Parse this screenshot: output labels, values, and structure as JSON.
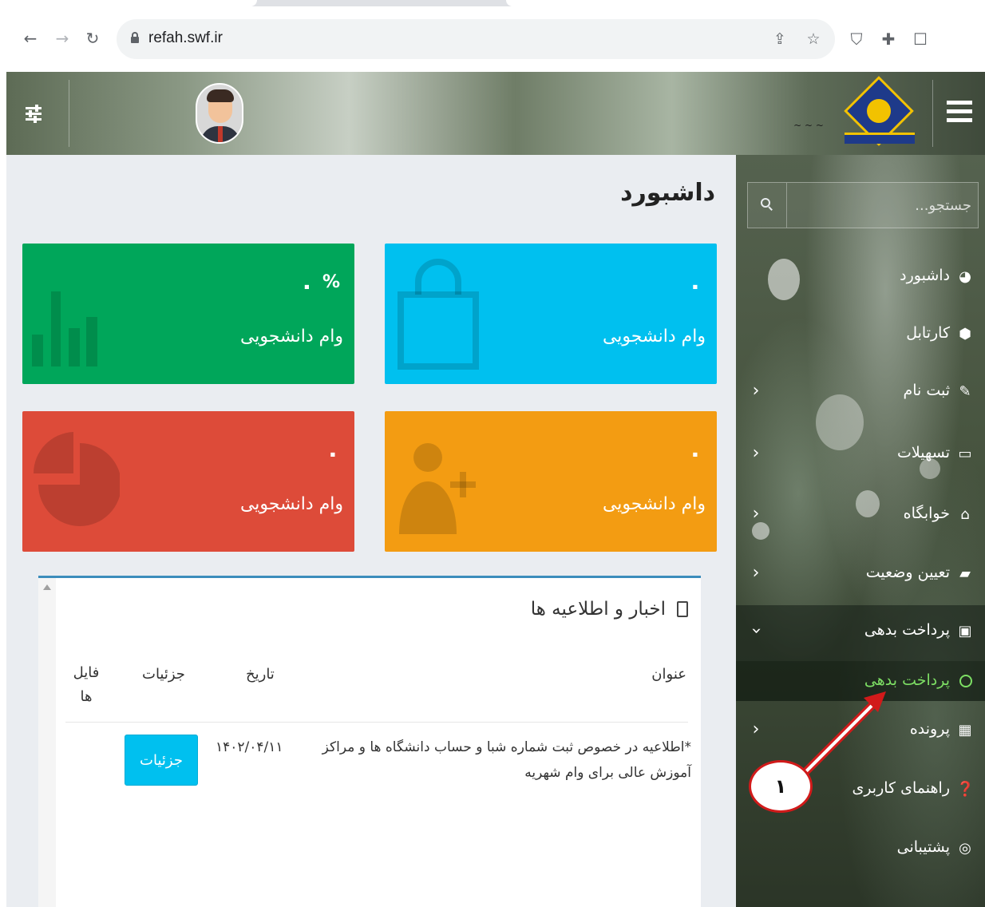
{
  "browser": {
    "url": "refah.swf.ir"
  },
  "search": {
    "placeholder": "جستجو..."
  },
  "sidebar": {
    "items": [
      {
        "label": "داشبورد",
        "icon": "dashboard-icon",
        "has_children": false
      },
      {
        "label": "کارتابل",
        "icon": "cube-icon",
        "has_children": false
      },
      {
        "label": "ثبت نام",
        "icon": "edit-icon",
        "has_children": true
      },
      {
        "label": "تسهیلات",
        "icon": "credit-card-icon",
        "has_children": true
      },
      {
        "label": "خوابگاه",
        "icon": "home-icon",
        "has_children": true
      },
      {
        "label": "تعیین وضعیت",
        "icon": "book-icon",
        "has_children": true
      },
      {
        "label": "پرداخت بدهی",
        "icon": "money-icon",
        "has_children": true,
        "expanded": true
      },
      {
        "label": "پرونده",
        "icon": "folder-icon",
        "has_children": true
      },
      {
        "label": "راهنمای کاربری",
        "icon": "question-icon",
        "has_children": false
      },
      {
        "label": "پشتیبانی",
        "icon": "lifebuoy-icon",
        "has_children": false
      }
    ],
    "submenu": {
      "label": "پرداخت بدهی",
      "color": "#7ddf64"
    }
  },
  "main": {
    "title": "داشبورد",
    "cards": [
      {
        "value": "۰",
        "label": "وام دانشجویی",
        "color": "#00c0ef",
        "icon": "shopping-bag-icon"
      },
      {
        "value": "۰",
        "label": "وام دانشجویی",
        "color": "#00a65a",
        "icon": "bar-chart-icon",
        "suffix": "%"
      },
      {
        "value": "۰",
        "label": "وام دانشجویی",
        "color": "#f39c12",
        "icon": "user-add-icon"
      },
      {
        "value": "۰",
        "label": "وام دانشجویی",
        "color": "#dd4b39",
        "icon": "pie-chart-icon"
      }
    ],
    "news": {
      "title": "اخبار و اطلاعیه ها",
      "columns": {
        "title": "عنوان",
        "date": "تاریخ",
        "details": "جزئیات",
        "file": "فایل ها"
      },
      "rows": [
        {
          "title": "*اطلاعیه در خصوص ثبت شماره شبا و حساب دانشگاه ها و مراکز آموزش عالی برای وام شهریه",
          "date": "۱۴۰۲/۰۴/۱۱",
          "details_button": "جزئیات"
        }
      ]
    }
  },
  "annotation": {
    "badge": "۱",
    "color": "#d11a1a"
  }
}
